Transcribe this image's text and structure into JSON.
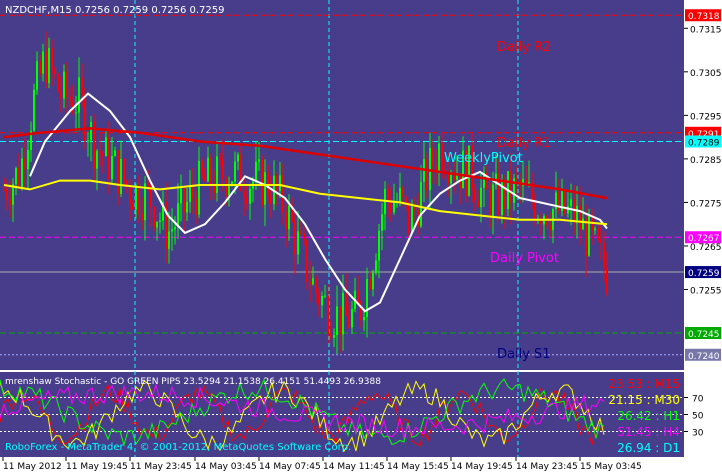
{
  "colors": {
    "chart_bg": "#483D8B",
    "axis_bg": "#ffffff",
    "bull": "#00FF00",
    "bear": "#FF0000",
    "ma_white": "#FFFFFF",
    "ma_yellow": "#FFFF00",
    "ma_red": "#DD0000",
    "r2": "#FF0000",
    "r1": "#FF0000",
    "weekly_pivot": "#00FFFF",
    "daily_pivot": "#FF00FF",
    "s1": "#00AA00",
    "cyan_vert": "#00FFFF",
    "stoch_green": "#00FF00",
    "stoch_yellow": "#FFFF00",
    "stoch_magenta": "#FF00FF",
    "stoch_red": "#FF0000"
  },
  "main": {
    "header": "NZDCHF,M15  0.7256 0.7259 0.7256 0.7259",
    "levels": {
      "r2": {
        "label": "Daily R2",
        "price": "0.7318",
        "value": 0.7318
      },
      "r1": {
        "label": "Daily R1",
        "price": "0.7291",
        "value": 0.7291
      },
      "weekly": {
        "label": "WeeklyPivot",
        "price": "0.7289",
        "value": 0.7289
      },
      "daily": {
        "label": "Daily Pivot",
        "price": "0.7267",
        "value": 0.7267
      },
      "s1": {
        "label": "Daily S1",
        "price": "0.7245",
        "value": 0.7245
      },
      "bottom": {
        "price": "0.7240",
        "value": 0.724
      }
    },
    "current_price": {
      "price": "0.7259",
      "value": 0.7259
    },
    "y_ticks": [
      "0.7315",
      "0.7305",
      "0.7295",
      "0.7285",
      "0.7275",
      "0.7265",
      "0.7255"
    ],
    "y_tick_values": [
      0.7315,
      0.7305,
      0.7295,
      0.7285,
      0.7275,
      0.7265,
      0.7255
    ],
    "y_range": [
      0.72365,
      0.73215
    ]
  },
  "sub": {
    "title": "mrenshaw Stochastic - GO GREEN PIPS 23.5294 21.1538 26.4151 51.4493 26.9388",
    "y_ticks": [
      "70",
      "50",
      "30"
    ],
    "y_tick_values": [
      70,
      50,
      30
    ],
    "y_range": [
      0,
      100
    ],
    "tf_labels": [
      {
        "text": "23.53 : M15",
        "color": "#FF0000"
      },
      {
        "text": "21.15 : M30",
        "color": "#FFFF00"
      },
      {
        "text": "26.42 : H1",
        "color": "#00FF00"
      },
      {
        "text": "51.45 : H4",
        "color": "#FF00FF"
      },
      {
        "text": "26.94 : D1",
        "color": "#00FFFF"
      }
    ],
    "copyright": "RoboForex - MetaTrader 4, © 2001-2012, MetaQuotes Software Corp."
  },
  "x_axis": {
    "labels": [
      "11 May 2012",
      "11 May 19:45",
      "11 May 23:45",
      "14 May 03:45",
      "14 May 07:45",
      "14 May 11:45",
      "14 May 15:45",
      "14 May 19:45",
      "14 May 23:45",
      "15 May 03:45"
    ]
  }
}
